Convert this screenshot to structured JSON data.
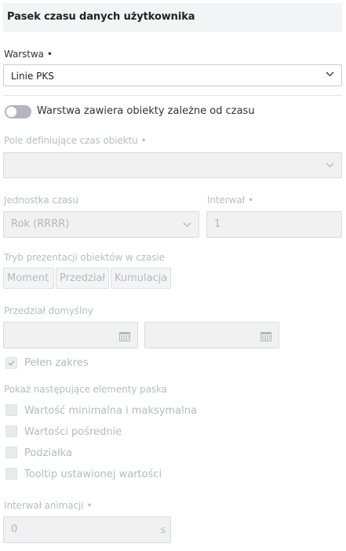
{
  "header": {
    "title": "Pasek czasu danych użytkownika"
  },
  "layer": {
    "label": "Warstwa",
    "required": "•",
    "value": "Linie PKS",
    "chevron_icon": "chevron-down-icon"
  },
  "time_toggle": {
    "label": "Warstwa zawiera obiekty zależne od czasu",
    "on": false
  },
  "time_field": {
    "label": "Pole definiujące czas obiektu",
    "required": "•",
    "value": ""
  },
  "time_unit": {
    "label": "Jednostka czasu",
    "value": "Rok (RRRR)"
  },
  "interval": {
    "label": "Interwał",
    "required": "•",
    "value": "1"
  },
  "presentation": {
    "label": "Tryb prezentacji obiektów w czasie",
    "options": [
      "Moment",
      "Przedział",
      "Kumulacja"
    ]
  },
  "default_range": {
    "label": "Przedział domyślny",
    "start": "",
    "end": "",
    "icon": "calendar-icon"
  },
  "full_range": {
    "label": "Pełen zakres",
    "checked": true
  },
  "show_elements": {
    "label": "Pokaż następujące elementy paska",
    "items": [
      {
        "label": "Wartość minimalna i maksymalna",
        "checked": false
      },
      {
        "label": "Wartości pośrednie",
        "checked": false
      },
      {
        "label": "Podziałka",
        "checked": false
      },
      {
        "label": "Tooltip ustawionej wartości",
        "checked": false
      }
    ]
  },
  "animation_interval": {
    "label": "Interwał animacji",
    "required": "•",
    "value": "0",
    "unit": "s"
  },
  "colors": {
    "header_bg": "#f2f4f6",
    "disabled_text": "#b6babe",
    "border": "#c9cdd2"
  }
}
